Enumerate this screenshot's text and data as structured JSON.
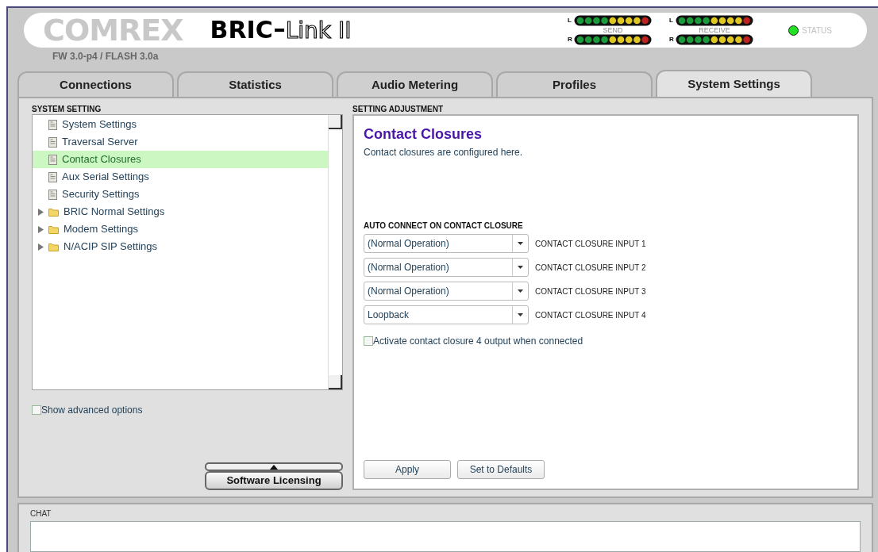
{
  "header": {
    "brand": "COMREX",
    "product": "BRIC",
    "product_suffix": "Link II",
    "firmware": "FW 3.0-p4 / FLASH 3.0a",
    "meters": [
      {
        "label": "SEND",
        "channels": [
          "L",
          "R"
        ]
      },
      {
        "label": "RECEIVE",
        "channels": [
          "L",
          "R"
        ]
      }
    ],
    "status": {
      "label": "STATUS",
      "on": true
    }
  },
  "tabs": [
    {
      "label": "Connections",
      "selected": false
    },
    {
      "label": "Statistics",
      "selected": false
    },
    {
      "label": "Audio Metering",
      "selected": false
    },
    {
      "label": "Profiles",
      "selected": false
    },
    {
      "label": "System Settings",
      "selected": true
    }
  ],
  "sidebar": {
    "title": "SYSTEM SETTING",
    "items": [
      {
        "label": "System Settings",
        "kind": "page",
        "selected": false
      },
      {
        "label": "Traversal Server",
        "kind": "page",
        "selected": false
      },
      {
        "label": "Contact Closures",
        "kind": "page",
        "selected": true
      },
      {
        "label": "Aux Serial Settings",
        "kind": "page",
        "selected": false
      },
      {
        "label": "Security Settings",
        "kind": "page",
        "selected": false
      },
      {
        "label": "BRIC Normal Settings",
        "kind": "folder",
        "expanded": false,
        "selected": false
      },
      {
        "label": "Modem Settings",
        "kind": "folder",
        "expanded": false,
        "selected": false
      },
      {
        "label": "N/ACIP SIP Settings",
        "kind": "folder",
        "expanded": false,
        "selected": false
      }
    ],
    "advanced": {
      "label": "Show advanced options",
      "checked": false
    },
    "licensing_button": "Software Licensing"
  },
  "adjustment": {
    "title": "SETTING ADJUSTMENT",
    "heading": "Contact Closures",
    "description": "Contact closures are configured here.",
    "section": "AUTO CONNECT ON CONTACT CLOSURE",
    "inputs": [
      {
        "value": "(Normal Operation)",
        "label": "CONTACT CLOSURE INPUT 1"
      },
      {
        "value": "(Normal Operation)",
        "label": "CONTACT CLOSURE INPUT 2"
      },
      {
        "value": "(Normal Operation)",
        "label": "CONTACT CLOSURE INPUT 3"
      },
      {
        "value": "Loopback",
        "label": "CONTACT CLOSURE INPUT 4"
      }
    ],
    "output_option": {
      "label": "Activate contact closure 4 output when connected",
      "checked": false
    },
    "buttons": [
      "Apply",
      "Set to Defaults"
    ]
  },
  "chat": {
    "title": "CHAT"
  }
}
